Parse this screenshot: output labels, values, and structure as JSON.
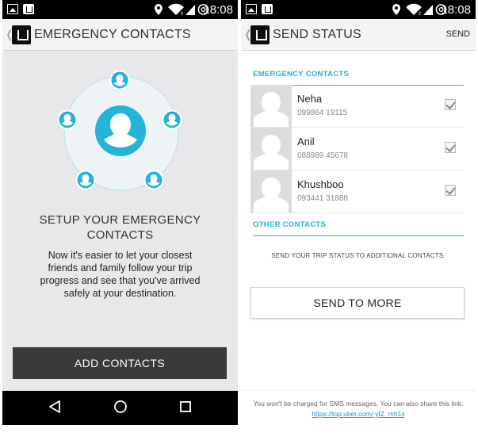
{
  "status_bar": {
    "time": "18:08"
  },
  "left": {
    "title": "EMERGENCY CONTACTS",
    "setup_title_line1": "SETUP YOUR EMERGENCY",
    "setup_title_line2": "CONTACTS",
    "description_line1": "Now it's easier to let your closest",
    "description_line2": "friends and family follow your trip",
    "description_line3": "progress and see that you've arrived",
    "description_line4": "safely at your destination.",
    "add_button": "ADD CONTACTS"
  },
  "right": {
    "title": "SEND STATUS",
    "action": "SEND",
    "emergency_header": "EMERGENCY CONTACTS",
    "contacts": [
      {
        "name": "Neha",
        "phone": "099864 19115",
        "checked": true
      },
      {
        "name": "Anil",
        "phone": "088989 45678",
        "checked": true
      },
      {
        "name": "Khushboo",
        "phone": "093441 31888",
        "checked": true
      }
    ],
    "other_header": "OTHER CONTACTS",
    "other_sub": "SEND YOUR TRIP STATUS TO ADDITIONAL CONTACTS.",
    "send_more": "SEND TO MORE",
    "footer_text": "You won't be charged for SMS messages. You can also share this link:",
    "footer_link": "https://trip.uber.com/-yfZ_mh1s"
  },
  "colors": {
    "accent": "#1fb4d9",
    "button_dark": "#3a3a3c",
    "background": "#e8e8ea"
  },
  "icons": [
    "gallery-icon",
    "uber-icon",
    "location-icon",
    "wifi-icon",
    "signal-icon",
    "data-sync-icon",
    "back-icon",
    "home-icon",
    "recents-icon",
    "person-icon",
    "checkbox-icon"
  ]
}
